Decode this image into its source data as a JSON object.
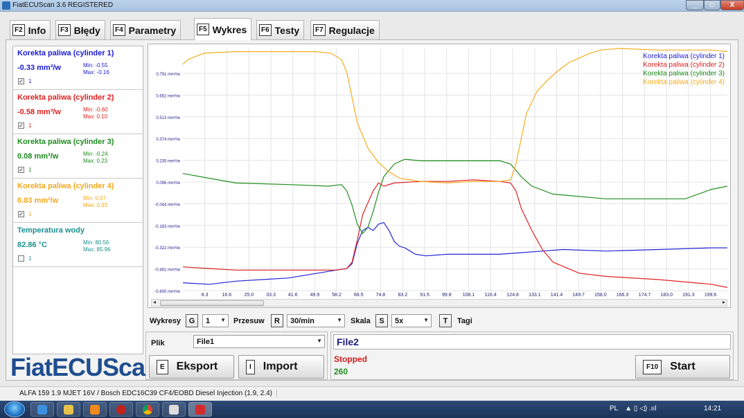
{
  "window": {
    "title": "FiatECUScan 3.6 REGISTERED",
    "min": "_",
    "max": "□",
    "close": "X"
  },
  "tabs": [
    {
      "key": "F2",
      "label": "Info"
    },
    {
      "key": "F3",
      "label": "Błędy"
    },
    {
      "key": "F4",
      "label": "Parametry"
    },
    {
      "key": "F5",
      "label": "Wykres"
    },
    {
      "key": "F6",
      "label": "Testy"
    },
    {
      "key": "F7",
      "label": "Regulacje"
    }
  ],
  "sensors": [
    {
      "name": "Korekta paliwa (cylinder 1)",
      "value": "-0.33 mm³/w",
      "min": "Min: -0.55",
      "max": "Max: -0.16",
      "color": "#1a1ad4",
      "index": "1",
      "checked": "✓"
    },
    {
      "name": "Korekta paliwa (cylinder 2)",
      "value": "-0.58 mm³/w",
      "min": "Min: -0.60",
      "max": "Max: 0.10",
      "color": "#e01e1e",
      "index": "1",
      "checked": "✓"
    },
    {
      "name": "Korekta paliwa (cylinder 3)",
      "value": "0.08 mm³/w",
      "min": "Min: -0.24",
      "max": "Max: 0.23",
      "color": "#1f8a1f",
      "index": "1",
      "checked": "✓"
    },
    {
      "name": "Korekta paliwa (cylinder 4)",
      "value": "0.83 mm³/w",
      "min": "Min: 0.07",
      "max": "Max: 0.93",
      "color": "#f2a81d",
      "index": "1",
      "checked": "✓"
    },
    {
      "name": "Temperatura wody",
      "value": "82.86 °C",
      "min": "Min: 80.56",
      "max": "Max: 85.96",
      "color": "#19908f",
      "index": "1",
      "checked": ""
    }
  ],
  "logo": "FiatECUScan",
  "chart_data": {
    "type": "line",
    "ylabels": [
      "0.791 mm³/w",
      "0.652 mm³/w",
      "0.513 mm³/w",
      "0.374 mm³/w",
      "0.235 mm³/w",
      "0.096 mm³/w",
      "-0.044 mm³/w",
      "-0.183 mm³/w",
      "-0.322 mm³/w",
      "-0.461 mm³/w",
      "-0.600 mm³/w"
    ],
    "xlabels": [
      "8.3",
      "16.6",
      "25.0",
      "33.3",
      "41.6",
      "49.9",
      "58.2",
      "66.5",
      "74.8",
      "83.2",
      "91.5",
      "99.8",
      "108.1",
      "116.4",
      "124.8",
      "133.1",
      "141.4",
      "149.7",
      "158.0",
      "166.3",
      "174.7",
      "183.0",
      "191.3",
      "199.6"
    ],
    "xlim": [
      0,
      206
    ],
    "ylim": [
      -0.6,
      0.93
    ],
    "grid": true,
    "legend_position": "top-right",
    "series": [
      {
        "name": "Korekta paliwa (cylinder 1)",
        "color": "#2323d6",
        "x": [
          0,
          10,
          20,
          40,
          58,
          62,
          64,
          66,
          68,
          70,
          72,
          74,
          76,
          78,
          80,
          82,
          84,
          86,
          88,
          92,
          100,
          120,
          128,
          136,
          144,
          160,
          180,
          200,
          206
        ],
        "y": [
          -0.55,
          -0.56,
          -0.54,
          -0.52,
          -0.47,
          -0.46,
          -0.43,
          -0.3,
          -0.22,
          -0.2,
          -0.22,
          -0.18,
          -0.17,
          -0.22,
          -0.29,
          -0.32,
          -0.33,
          -0.35,
          -0.37,
          -0.38,
          -0.37,
          -0.37,
          -0.36,
          -0.35,
          -0.34,
          -0.35,
          -0.34,
          -0.33,
          -0.33
        ]
      },
      {
        "name": "Korekta paliwa (cylinder 2)",
        "color": "#e02020",
        "x": [
          0,
          10,
          20,
          40,
          58,
          62,
          64,
          66,
          68,
          72,
          74,
          76,
          80,
          90,
          100,
          110,
          120,
          124,
          126,
          128,
          132,
          136,
          140,
          150,
          160,
          180,
          200,
          206
        ],
        "y": [
          -0.45,
          -0.46,
          -0.47,
          -0.47,
          -0.47,
          -0.46,
          -0.42,
          -0.28,
          -0.12,
          0.03,
          0.08,
          0.06,
          0.08,
          0.09,
          0.09,
          0.1,
          0.09,
          0.08,
          0.03,
          -0.08,
          -0.22,
          -0.34,
          -0.42,
          -0.49,
          -0.51,
          -0.53,
          -0.56,
          -0.58
        ]
      },
      {
        "name": "Korekta paliwa (cylinder 3)",
        "color": "#1e8e1e",
        "x": [
          0,
          10,
          20,
          40,
          55,
          60,
          62,
          64,
          66,
          68,
          70,
          72,
          74,
          76,
          80,
          84,
          90,
          100,
          120,
          124,
          128,
          132,
          140,
          160,
          190,
          200,
          206
        ],
        "y": [
          0.14,
          0.11,
          0.08,
          0.07,
          0.06,
          0.07,
          0.03,
          -0.06,
          -0.18,
          -0.24,
          -0.2,
          -0.1,
          0.02,
          0.12,
          0.2,
          0.23,
          0.22,
          0.22,
          0.22,
          0.2,
          0.12,
          0.06,
          0.01,
          -0.02,
          -0.02,
          0.04,
          0.06
        ]
      },
      {
        "name": "Korekta paliwa (cylinder 4)",
        "color": "#f5ac1e",
        "x": [
          0,
          2,
          8,
          20,
          50,
          56,
          60,
          62,
          64,
          66,
          70,
          74,
          78,
          82,
          86,
          90,
          100,
          110,
          120,
          124,
          126,
          128,
          130,
          134,
          138,
          142,
          146,
          150,
          154,
          158,
          165,
          180,
          200,
          206
        ],
        "y": [
          0.83,
          0.86,
          0.9,
          0.91,
          0.91,
          0.9,
          0.86,
          0.78,
          0.62,
          0.46,
          0.3,
          0.21,
          0.15,
          0.11,
          0.1,
          0.09,
          0.08,
          0.09,
          0.09,
          0.1,
          0.2,
          0.36,
          0.52,
          0.66,
          0.73,
          0.79,
          0.84,
          0.87,
          0.9,
          0.92,
          0.93,
          0.92,
          0.92,
          0.91
        ]
      }
    ]
  },
  "controls": {
    "wykresy_label": "Wykresy",
    "wykresy_key": "G",
    "wykresy_value": "1",
    "przesuw_label": "Przesuw",
    "przesuw_key": "R",
    "przesuw_value": "30/min",
    "skala_label": "Skala",
    "skala_key": "S",
    "skala_value": "5x",
    "tagi_key": "T",
    "tagi_label": "Tagi"
  },
  "file": {
    "label": "Plik",
    "value": "File1",
    "export_key": "E",
    "export_label": "Eksport",
    "import_key": "I",
    "import_label": "Import"
  },
  "status": {
    "file": "File2",
    "state": "Stopped",
    "count": "260",
    "start_key": "F10",
    "start_label": "Start"
  },
  "statusbar": {
    "text": "ALFA 159 1.9 MJET 16V / Bosch EDC16C39 CF4/EOBD Diesel Injection (1.9, 2.4)"
  },
  "taskbar": {
    "lang": "PL",
    "tray": "▲ ▯ ◁) .ııl",
    "clock": "14:21"
  }
}
